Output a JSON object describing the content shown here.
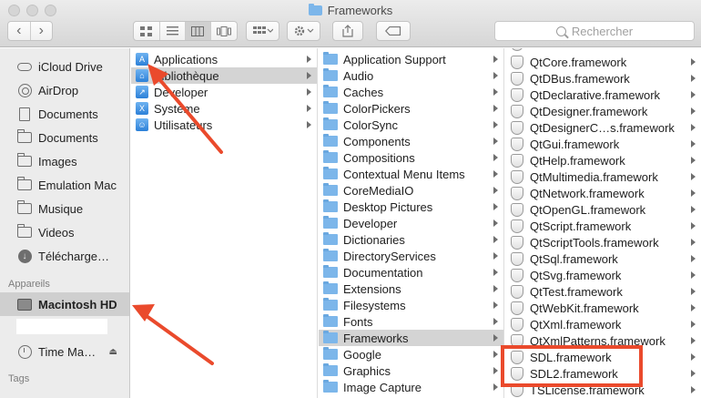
{
  "window": {
    "title": "Frameworks"
  },
  "toolbar": {
    "back_glyph": "‹",
    "forward_glyph": "›",
    "search_placeholder": "Rechercher"
  },
  "sidebar": {
    "favorites": [
      {
        "label": "iCloud Drive",
        "icon": "cloud-icon"
      },
      {
        "label": "AirDrop",
        "icon": "airdrop-icon"
      },
      {
        "label": "Documents",
        "icon": "document-icon"
      },
      {
        "label": "Documents",
        "icon": "folder-icon"
      },
      {
        "label": "Images",
        "icon": "folder-icon"
      },
      {
        "label": "Emulation Mac",
        "icon": "folder-icon"
      },
      {
        "label": "Musique",
        "icon": "folder-icon"
      },
      {
        "label": "Videos",
        "icon": "folder-icon"
      },
      {
        "label": "Télécharge…",
        "icon": "download-icon"
      }
    ],
    "devices_heading": "Appareils",
    "devices": [
      {
        "label": "Macintosh HD",
        "icon": "hard-drive-icon",
        "selected": true
      },
      {
        "label": "Time Ma…",
        "icon": "time-machine-icon"
      }
    ],
    "tags_heading": "Tags"
  },
  "column1": {
    "items": [
      {
        "label": "Applications",
        "icon": "app-folder-icon"
      },
      {
        "label": "Bibliothèque",
        "icon": "library-folder-icon",
        "selected": true
      },
      {
        "label": "Developer",
        "icon": "developer-icon"
      },
      {
        "label": "Système",
        "icon": "system-folder-icon"
      },
      {
        "label": "Utilisateurs",
        "icon": "users-folder-icon"
      }
    ]
  },
  "column2": {
    "items": [
      "Application Support",
      "Audio",
      "Caches",
      "ColorPickers",
      "ColorSync",
      "Components",
      "Compositions",
      "Contextual Menu Items",
      "CoreMediaIO",
      "Desktop Pictures",
      "Developer",
      "Dictionaries",
      "DirectoryServices",
      "Documentation",
      "Extensions",
      "Filesystems",
      "Fonts",
      "Frameworks",
      "Google",
      "Graphics",
      "Image Capture"
    ],
    "selected": "Frameworks"
  },
  "column3": {
    "items": [
      "QtCore.framework",
      "QtDBus.framework",
      "QtDeclarative.framework",
      "QtDesigner.framework",
      "QtDesignerC…s.framework",
      "QtGui.framework",
      "QtHelp.framework",
      "QtMultimedia.framework",
      "QtNetwork.framework",
      "QtOpenGL.framework",
      "QtScript.framework",
      "QtScriptTools.framework",
      "QtSql.framework",
      "QtSvg.framework",
      "QtTest.framework",
      "QtWebKit.framework",
      "QtXml.framework",
      "QtXmlPatterns.framework",
      "SDL.framework",
      "SDL2.framework",
      "TSLicense.framework"
    ],
    "highlighted": [
      "SDL.framework",
      "SDL2.framework"
    ]
  },
  "annotations": {
    "color": "#ea4a2c"
  }
}
